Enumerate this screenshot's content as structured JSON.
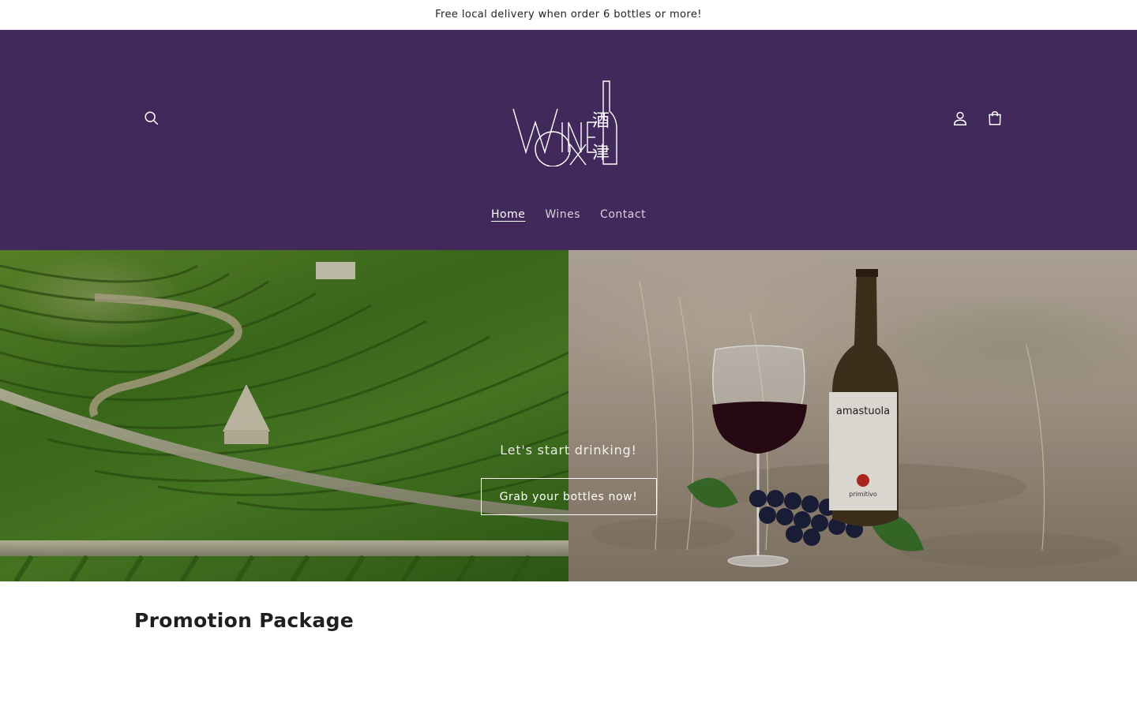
{
  "announcement": {
    "text": "Free local delivery when order 6 bottles or more!"
  },
  "header": {
    "logo_alt": "Wine Ox",
    "logo_chinese": [
      "酒",
      "津"
    ],
    "icons": [
      "search-icon",
      "account-icon",
      "cart-icon"
    ]
  },
  "nav": {
    "items": [
      {
        "label": "Home",
        "active": true
      },
      {
        "label": "Wines",
        "active": false
      },
      {
        "label": "Contact",
        "active": false
      }
    ]
  },
  "hero": {
    "tagline": "Let's start drinking!",
    "button_label": "Grab your bottles now!",
    "bottle_label": "amastuola",
    "bottle_sublabel": "primitivo"
  },
  "section": {
    "title": "Promotion Package"
  },
  "colors": {
    "header_bg": "#41295c",
    "text": "#1a1a1a"
  }
}
